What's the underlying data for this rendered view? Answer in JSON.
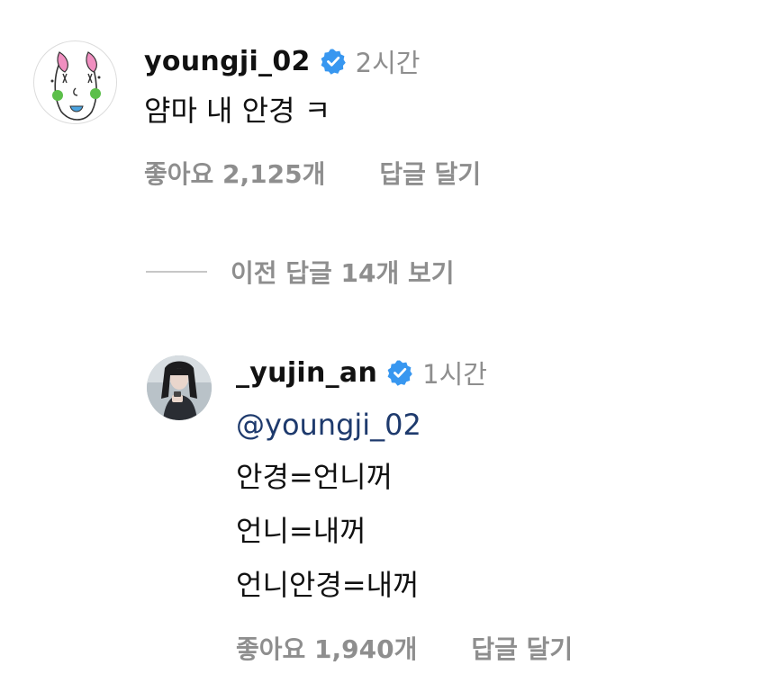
{
  "comments": [
    {
      "username": "youngji_02",
      "time": "2시간",
      "text": "얌마 내 안경 ㅋ",
      "likes": "좋아요 2,125개",
      "reply_label": "답글 달기"
    }
  ],
  "view_replies_label": "이전 답글 14개 보기",
  "reply": {
    "username": "_yujin_an",
    "time": "1시간",
    "mention": "@youngji_02",
    "lines": [
      "안경=언니꺼",
      "언니=내꺼",
      "언니안경=내꺼"
    ],
    "likes": "좋아요 1,940개",
    "reply_label": "답글 달기"
  },
  "colors": {
    "verified_badge": "#3897f0",
    "secondary_text": "#8e8e8e",
    "mention": "#1e3a6d"
  },
  "icons": {
    "verified": "verified-badge-icon"
  }
}
